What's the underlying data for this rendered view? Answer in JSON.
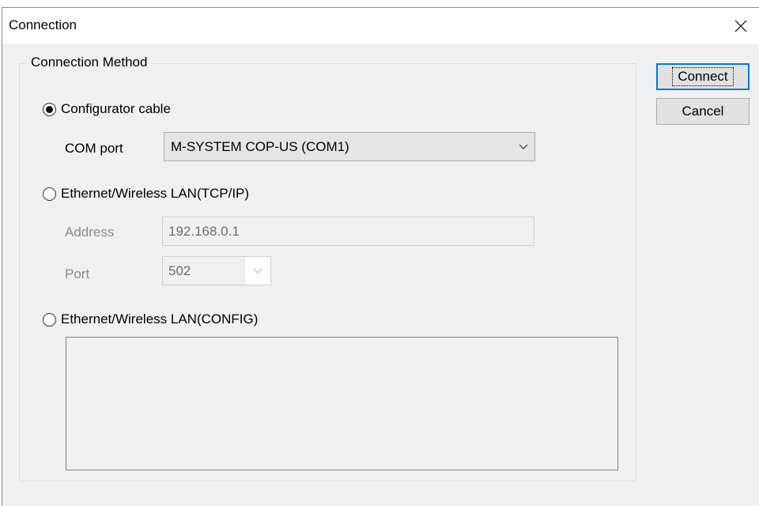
{
  "dialog": {
    "title": "Connection",
    "group_label": "Connection Method",
    "options": {
      "cable": {
        "label": "Configurator cable",
        "checked": true
      },
      "tcp": {
        "label": "Ethernet/Wireless LAN(TCP/IP)",
        "checked": false
      },
      "config": {
        "label": "Ethernet/Wireless LAN(CONFIG)",
        "checked": false
      }
    },
    "com_port": {
      "label": "COM port",
      "value": "M-SYSTEM COP-US (COM1)"
    },
    "address": {
      "label": "Address",
      "value": "192.168.0.1"
    },
    "port": {
      "label": "Port",
      "value": "502"
    },
    "buttons": {
      "connect": "Connect",
      "cancel": "Cancel"
    }
  },
  "icons": {
    "close": "close-icon",
    "dropdown": "chevron-down-icon",
    "radio": "radio-icon"
  }
}
